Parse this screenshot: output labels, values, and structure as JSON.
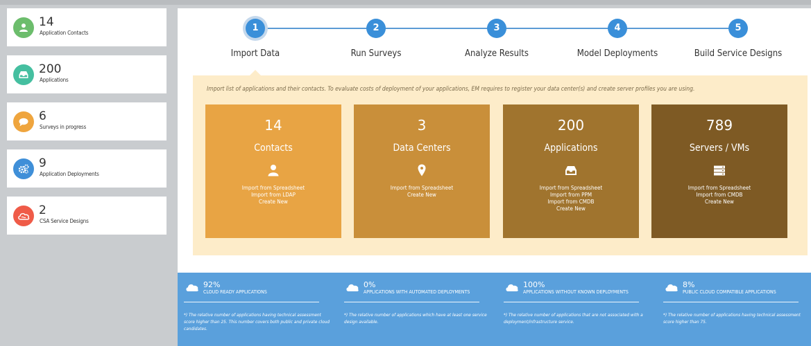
{
  "sidebar": {
    "cards": [
      {
        "value": "14",
        "label": "Application Contacts",
        "color": "#6cbd6c",
        "icon": "person-icon"
      },
      {
        "value": "200",
        "label": "Applications",
        "color": "#45bfa0",
        "icon": "inbox-icon"
      },
      {
        "value": "6",
        "label": "Surveys in progress",
        "color": "#efa53e",
        "icon": "chat-bubble-icon"
      },
      {
        "value": "9",
        "label": "Application Deployments",
        "color": "#3f8fd8",
        "icon": "gears-icon"
      },
      {
        "value": "2",
        "label": "CSA Service Designs",
        "color": "#ef5b48",
        "icon": "cloud-icon"
      }
    ]
  },
  "stepper": {
    "steps": [
      {
        "number": "1",
        "label": "Import Data",
        "active": true
      },
      {
        "number": "2",
        "label": "Run Surveys"
      },
      {
        "number": "3",
        "label": "Analyze Results"
      },
      {
        "number": "4",
        "label": "Model Deployments"
      },
      {
        "number": "5",
        "label": "Build Service Designs"
      }
    ],
    "color": "#3a8fd9"
  },
  "panel": {
    "description": "Import list of applications and their contacts. To evaluate costs of deployment of your applications, EM requires to register your data center(s) and create server profiles you are using.",
    "tiles": [
      {
        "value": "14",
        "title": "Contacts",
        "icon": "person-icon",
        "color": "#e8a444",
        "links": [
          "Import from Spreadsheet",
          "Import from LDAP",
          "Create New"
        ]
      },
      {
        "value": "3",
        "title": "Data Centers",
        "icon": "map-pin-icon",
        "color": "#c98f3a",
        "links": [
          "Import from Spreadsheet",
          "Create New"
        ]
      },
      {
        "value": "200",
        "title": "Applications",
        "icon": "inbox-icon",
        "color": "#a0742e",
        "links": [
          "Import from Spreadsheet",
          "Import from PPM",
          "Import from CMDB",
          "Create New"
        ]
      },
      {
        "value": "789",
        "title": "Servers / VMs",
        "icon": "server-icon",
        "color": "#7e5a24",
        "links": [
          "Import from Spreadsheet",
          "Import from CMDB",
          "Create New"
        ]
      }
    ]
  },
  "metrics": [
    {
      "percent": "92%",
      "title": "CLOUD READY APPLICATIONS",
      "note": "*) The relative number of applications having technical assessment score higher than 25. This number covers both public and private cloud candidates.",
      "icon": "cloud-icon"
    },
    {
      "percent": "0%",
      "title": "APPLICATIONS WITH AUTOMATED DEPLOYMENTS",
      "note": "*) The relative number of applications which have at least one service design available.",
      "icon": "cloud-icon"
    },
    {
      "percent": "100%",
      "title": "APPLICATIONS WITHOUT KNOWN DEPLOYMENTS",
      "note": "*) The relative number of applications that are not associated with a deployment/infrastructure service.",
      "icon": "cloud-icon"
    },
    {
      "percent": "8%",
      "title": "PUBLIC CLOUD COMPATIBLE APPLICATIONS",
      "note": "*) The relative number of applications having technical assessment score higher than 75.",
      "icon": "cloud-icon"
    }
  ]
}
